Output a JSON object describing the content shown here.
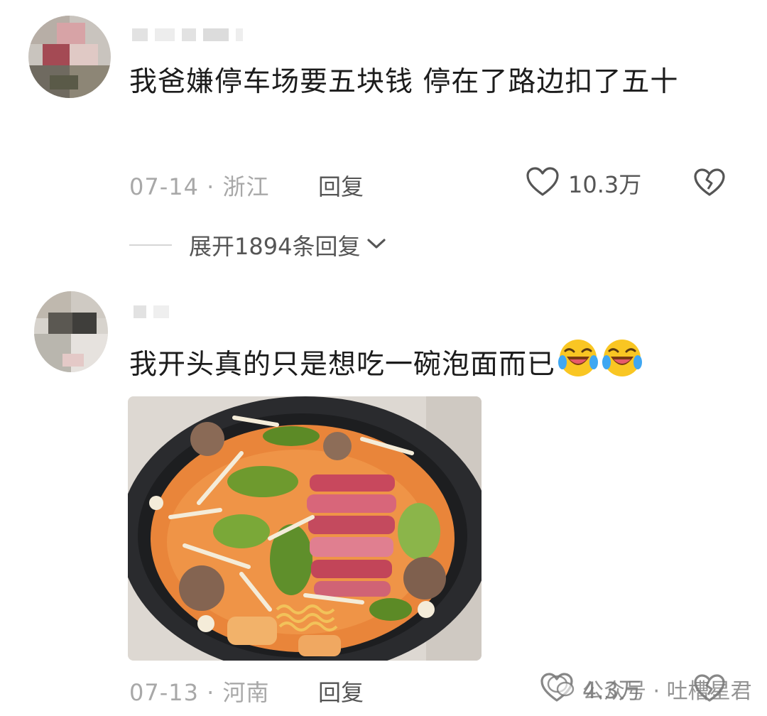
{
  "comments": [
    {
      "text": "我爸嫌停车场要五块钱 停在了路边扣了五十",
      "date": "07-14",
      "location": "浙江",
      "reply_label": "回复",
      "likes": "10.3万",
      "expand_replies": "展开1894条回复"
    },
    {
      "text": "我开头真的只是想吃一碗泡面而已",
      "date": "07-13",
      "location": "河南",
      "reply_label": "回复",
      "likes": "4.3万"
    }
  ],
  "icons": {
    "like": "heart-outline-icon",
    "dislike": "broken-heart-icon",
    "expand": "chevron-down-icon",
    "emoji": "rolling-on-floor-laughing-emoji"
  },
  "watermark": {
    "text": "公众号 · 吐槽星君"
  },
  "colors": {
    "text": "#1c1c1c",
    "meta": "#a8a8a8",
    "action": "#555555"
  }
}
